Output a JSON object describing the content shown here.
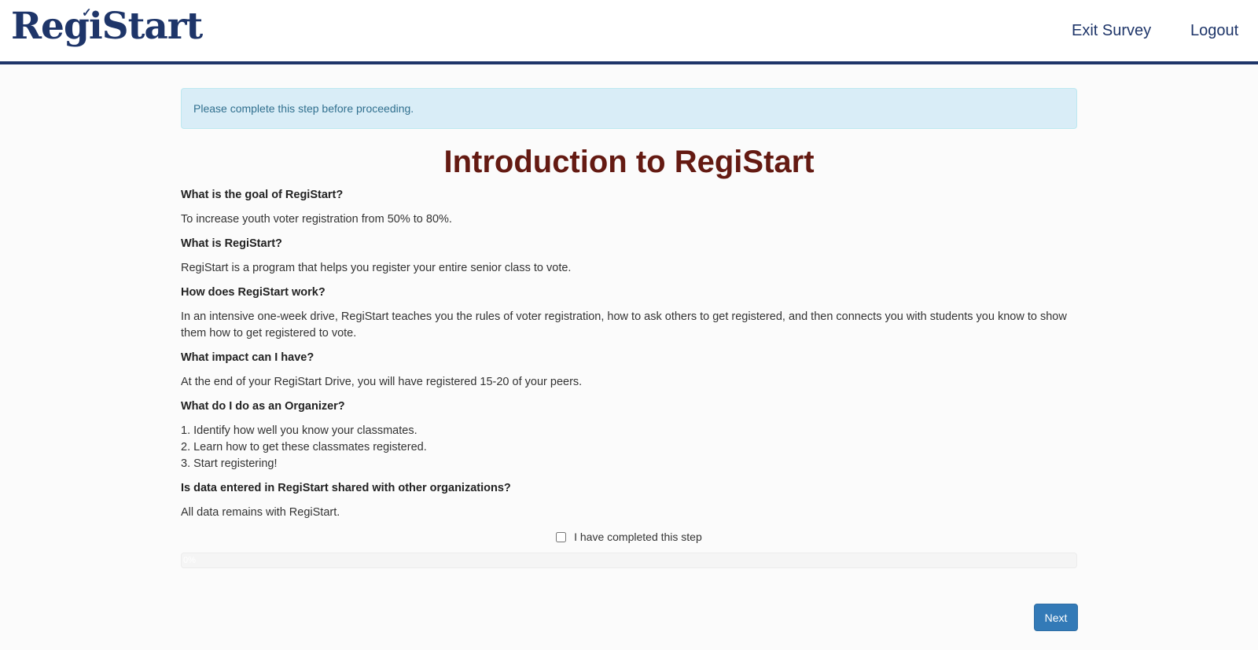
{
  "header": {
    "logo_text": "RegiStart",
    "nav": {
      "exit_label": "Exit Survey",
      "logout_label": "Logout"
    }
  },
  "alert": {
    "text": "Please complete this step before proceeding."
  },
  "page": {
    "title": "Introduction to RegiStart"
  },
  "faq": [
    {
      "q": "What is the goal of RegiStart?",
      "a": "To increase youth voter registration from 50% to 80%."
    },
    {
      "q": "What is RegiStart?",
      "a": "RegiStart is a program that helps you register your entire senior class to vote."
    },
    {
      "q": "How does RegiStart work?",
      "a": "In an intensive one-week drive, RegiStart teaches you the rules of voter registration, how to ask others to get registered, and then connects you with students you know to show them how to get registered to vote."
    },
    {
      "q": "What impact can I have?",
      "a": "At the end of your RegiStart Drive, you will have registered 15-20 of your peers."
    },
    {
      "q": "What do I do as an Organizer?",
      "steps": [
        "1. Identify how well you know your classmates.",
        "2. Learn how to get these classmates registered.",
        "3. Start registering!"
      ]
    },
    {
      "q": "Is data entered in RegiStart shared with other organizations?",
      "a": "All data remains with RegiStart."
    }
  ],
  "completion": {
    "checkbox_label": "I have completed this step",
    "checked": false
  },
  "progress": {
    "value_percent": 0,
    "label": "0%"
  },
  "footer": {
    "next_label": "Next"
  },
  "colors": {
    "brand": "#1e3569",
    "title": "#641a12",
    "button": "#337ab7",
    "alert_bg": "#d9edf7"
  }
}
